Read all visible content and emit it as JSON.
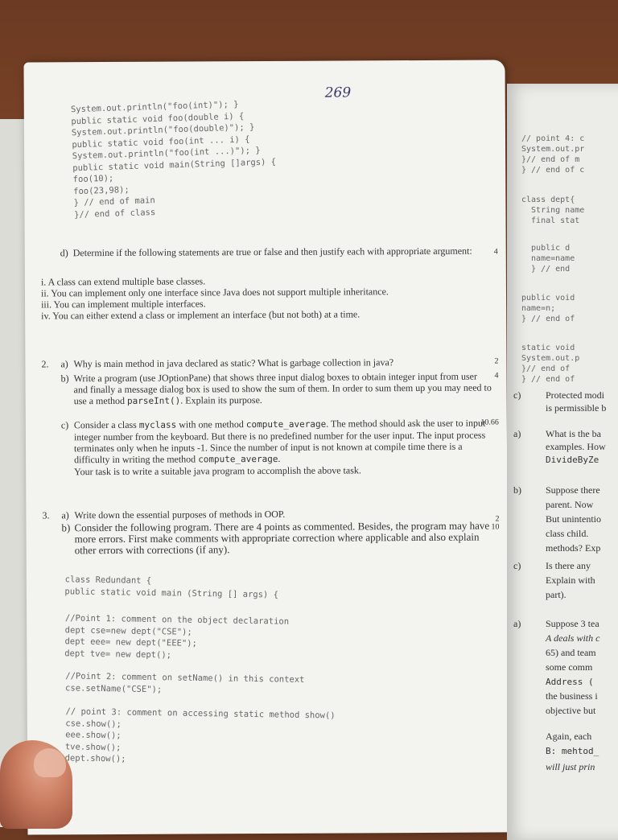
{
  "page_number_handwritten": "269",
  "top_code": "System.out.println(\"foo(int)\"); }\npublic static void foo(double i) {\nSystem.out.println(\"foo(double)\"); }\npublic static void foo(int ... i) {\nSystem.out.println(\"foo(int ...)\"); }\npublic static void main(String []args) {\nfoo(10);\nfoo(23,98);\n} // end of main\n}// end of class",
  "q1d": {
    "letter": "d)",
    "text": "Determine if the following statements are true or false and then justify each with appropriate argument:",
    "mark": "4",
    "items": [
      "i. A class can extend multiple base classes.",
      "ii. You can implement only one interface since Java does not support multiple inheritance.",
      "iii. You can implement multiple interfaces.",
      "iv. You can either extend a class or implement an interface (but not both) at a time."
    ]
  },
  "q2": {
    "number": "2.",
    "a": {
      "letter": "a)",
      "text": "Why is main method in java declared as static? What is garbage collection in java?",
      "mark": "2"
    },
    "b": {
      "letter": "b)",
      "text_1": "Write a program (use JOptionPane) that shows three input dialog boxes to obtain integer input from user and finally a message dialog box is used to show the sum of them. In order to sum them up you may need to use a method ",
      "code": "parseInt()",
      "text_2": ". Explain its purpose.",
      "mark": "4"
    },
    "c": {
      "letter": "c)",
      "text_1": "Consider a class ",
      "code_1": "myclass",
      "text_2": " with one method ",
      "code_2": "compute_average",
      "text_3": ". The method should ask the user to input integer number from the keyboard. But there is no predefined number for the user input. The input process terminates only when he inputs -1. Since the number of input is not known at compile time there is a difficulty in writing the method ",
      "code_3": "compute_average",
      "text_4": ".",
      "task": "Your task is to write a suitable java program to accomplish the above task.",
      "mark": "10.66"
    }
  },
  "q3": {
    "number": "3.",
    "a": {
      "letter": "a)",
      "text": "Write down the essential purposes of methods in OOP.",
      "mark": "2"
    },
    "b": {
      "letter": "b)",
      "text": "Consider the following program. There are 4 points as commented. Besides, the program may have more errors. First make comments with appropriate correction where applicable and also explain other errors with corrections (if any).",
      "mark": "10"
    }
  },
  "bottom_code_1": "class Redundant {\npublic static void main (String [] args) {",
  "bottom_code_2": "//Point 1: comment on the object declaration\ndept cse=new dept(\"CSE\");\ndept eee= new dept(\"EEE\");\ndept tve= new dept();",
  "bottom_code_3": "//Point 2: comment on setName() in this context\ncse.setName(\"CSE\");",
  "bottom_code_4": "// point 3: comment on accessing static method show()\ncse.show();\neee.show();\ntve.show();\ndept.show();",
  "right_page": {
    "code_1": "// point 4: c\nSystem.out.pr\n}// end of m\n} // end of c",
    "code_2": "class dept{\n  String name\n  final stat",
    "code_3": "  public d\n  name=name\n  } // end",
    "code_4": "public void\nname=n;\n} // end of",
    "code_5": "static void\nSystem.out.p\n}// end of\n} // end of",
    "lines": [
      {
        "label": "c)",
        "text": "Protected modi"
      },
      {
        "label": "",
        "text": "is permissible b"
      },
      {
        "label": "a)",
        "text": "What is the ba"
      },
      {
        "label": "",
        "text": "examples. How"
      },
      {
        "label": "",
        "text": "DivideByZe"
      },
      {
        "label": "b)",
        "text": "Suppose there"
      },
      {
        "label": "",
        "text": "parent. Now"
      },
      {
        "label": "",
        "text": "But unintentio"
      },
      {
        "label": "",
        "text": "class child."
      },
      {
        "label": "",
        "text": "methods? Exp"
      },
      {
        "label": "c)",
        "text": "Is there any"
      },
      {
        "label": "",
        "text": "Explain with"
      },
      {
        "label": "",
        "text": "part)."
      },
      {
        "label": "a)",
        "text": "Suppose 3 tea"
      },
      {
        "label": "",
        "text": "A deals with c"
      },
      {
        "label": "",
        "text": "65) and team"
      },
      {
        "label": "",
        "text": "some comm"
      },
      {
        "label": "",
        "text": "Address ("
      },
      {
        "label": "",
        "text": "the business i"
      },
      {
        "label": "",
        "text": "objective but"
      },
      {
        "label": "",
        "text": "Again, each"
      },
      {
        "label": "",
        "text": "B: mehtod_"
      },
      {
        "label": "",
        "text": "will just prin"
      }
    ]
  }
}
